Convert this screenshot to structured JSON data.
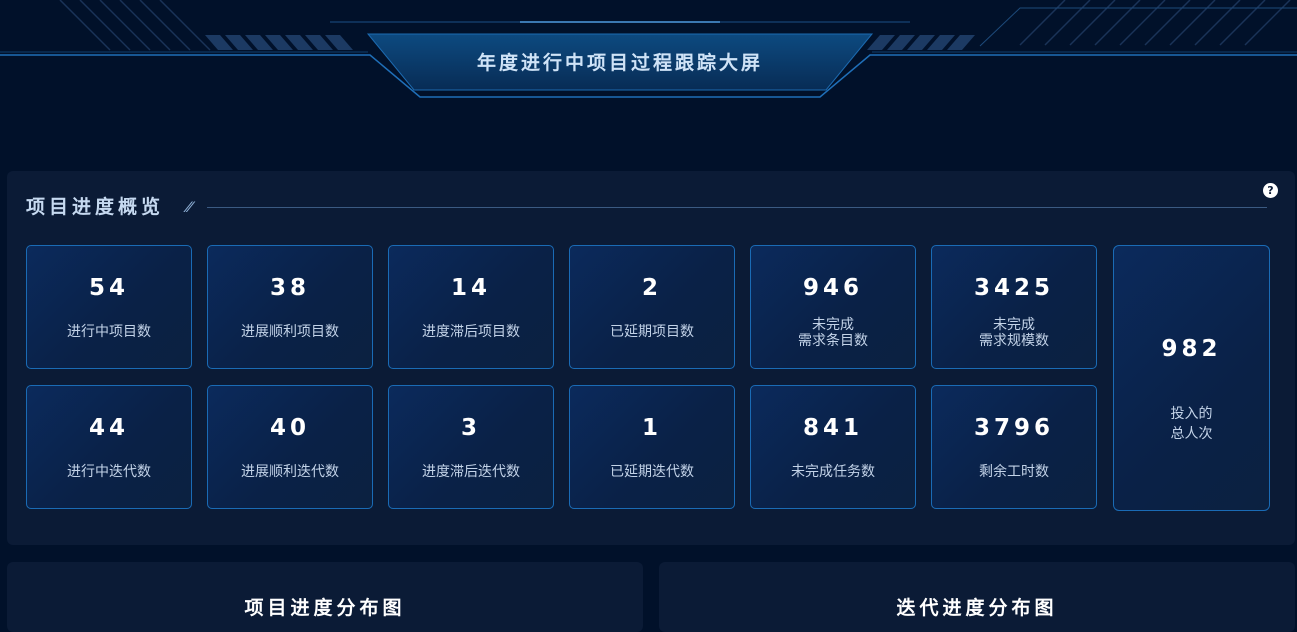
{
  "header": {
    "title": "年度进行中项目过程跟踪大屏"
  },
  "overview": {
    "title": "项目进度概览",
    "help": "?",
    "row1": [
      {
        "value": "54",
        "label": "进行中项目数"
      },
      {
        "value": "38",
        "label": "进展顺利项目数"
      },
      {
        "value": "14",
        "label": "进度滞后项目数"
      },
      {
        "value": "2",
        "label": "已延期项目数"
      },
      {
        "value": "946",
        "label_line1": "未完成",
        "label_line2": "需求条目数"
      },
      {
        "value": "3425",
        "label_line1": "未完成",
        "label_line2": "需求规模数"
      }
    ],
    "row2": [
      {
        "value": "44",
        "label": "进行中迭代数"
      },
      {
        "value": "40",
        "label": "进展顺利迭代数"
      },
      {
        "value": "3",
        "label": "进度滞后迭代数"
      },
      {
        "value": "1",
        "label": "已延期迭代数"
      },
      {
        "value": "841",
        "label": "未完成任务数"
      },
      {
        "value": "3796",
        "label": "剩余工时数"
      }
    ],
    "total": {
      "value": "982",
      "label_line1": "投入的",
      "label_line2": "总人次"
    }
  },
  "project_chart": {
    "title": "项目进度分布图"
  },
  "iteration_chart": {
    "title": "迭代进度分布图"
  }
}
